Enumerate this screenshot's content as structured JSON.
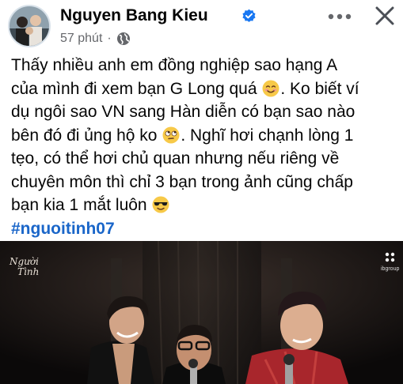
{
  "post": {
    "author_name": "Nguyen Bang Kieu",
    "time": "57 phút",
    "separator": "·",
    "icons": {
      "verified": "verified-badge-icon",
      "audience": "globe-icon",
      "more": "more-horizontal-icon",
      "close": "close-icon"
    },
    "body_lines": [
      "Thấy nhiều anh em đồng nghiệp sao hạng A",
      "của mình đi xem bạn G Long quá",
      ". Ko biết ví",
      "dụ ngôi sao VN sang Hàn diễn có bạn sao nào",
      "bên đó đi ủng hộ ko",
      ". Nghĩ hơi chạnh lòng 1",
      "tẹo, có thể hơi chủ quan nhưng nếu riêng về",
      "chuyên môn thì chỉ 3 bạn trong ảnh cũng chấp",
      "bạn kia 1 mắt luôn"
    ],
    "emojis": [
      "smiling-blush-emoji",
      "rolling-eyes-emoji",
      "sunglasses-emoji"
    ],
    "hashtag": "#nguoitinh07"
  },
  "photo": {
    "description_icon": "concert-stage-photo",
    "logo_left": "Người Tình",
    "logo_right": "ibgroup"
  },
  "colors": {
    "text": "#050505",
    "secondary": "#65676b",
    "link": "#1a66c9",
    "verified": "#1877f2",
    "photo_bg": "#0d0b0c"
  }
}
